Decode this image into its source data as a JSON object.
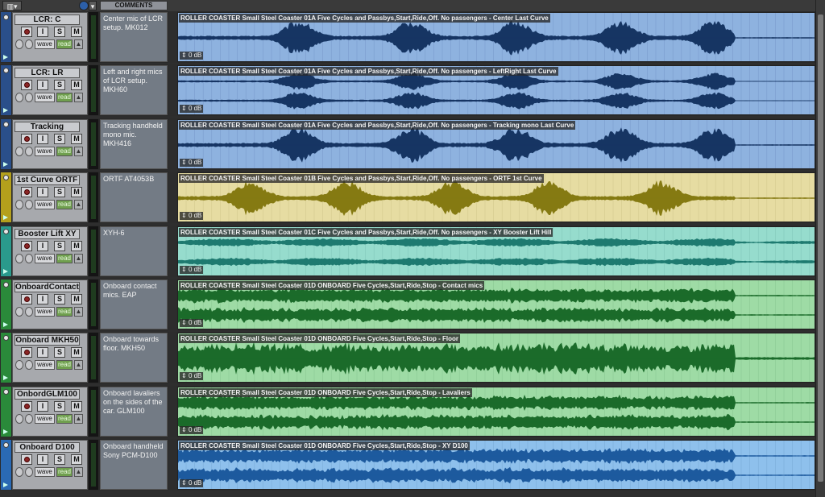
{
  "toolbar": {
    "view_menu_icon": "tracks-view-icon",
    "comments_header": "COMMENTS",
    "insert_icon": "info-icon"
  },
  "tracks": [
    {
      "name": "LCR: C",
      "comment": "Center mic of LCR setup. MK012",
      "clip_title": "ROLLER COASTER Small Steel Coaster 01A Five Cycles and Passbys,Start,Ride,Off. No passengers - Center Last Curve",
      "gain": "0 dB",
      "colors": {
        "strip": "#2a4f8a",
        "bg": "#8eb2df",
        "wave": "#163563",
        "grid": "#7a9ccd"
      },
      "wave_style": "mono-peaks",
      "buttons": {
        "rec": "",
        "input": "I",
        "solo": "S",
        "mute": "M",
        "wave": "wave",
        "read": "read",
        "auto": "▲"
      }
    },
    {
      "name": "LCR: LR",
      "comment": "Left and right mics of LCR setup. MKH60",
      "clip_title": "ROLLER COASTER Small Steel Coaster 01A Five Cycles and Passbys,Start,Ride,Off. No passengers - LeftRight Last Curve",
      "gain": "0 dB",
      "colors": {
        "strip": "#2a4f8a",
        "bg": "#8eb2df",
        "wave": "#163563",
        "grid": "#7a9ccd"
      },
      "wave_style": "stereo-peaks",
      "buttons": {
        "rec": "",
        "input": "I",
        "solo": "S",
        "mute": "M",
        "wave": "wave",
        "read": "read",
        "auto": "▲"
      }
    },
    {
      "name": "Tracking",
      "comment": "Tracking handheld mono mic. MKH416",
      "clip_title": "ROLLER COASTER Small Steel Coaster 01A Five Cycles and Passbys,Start,Ride,Off. No passengers - Tracking mono Last Curve",
      "gain": "0 dB",
      "colors": {
        "strip": "#2a4f8a",
        "bg": "#8eb2df",
        "wave": "#163563",
        "grid": "#7a9ccd"
      },
      "wave_style": "mono-peaks",
      "buttons": {
        "rec": "",
        "input": "I",
        "solo": "S",
        "mute": "M",
        "wave": "wave",
        "read": "read",
        "auto": "▲"
      }
    },
    {
      "name": "1st Curve ORTF",
      "comment": "ORTF AT4053B",
      "clip_title": "ROLLER COASTER Small Steel Coaster 01B Five Cycles and Passbys,Start,Ride,Off. No passengers - ORTF 1st Curve",
      "gain": "0 dB",
      "colors": {
        "strip": "#b4a01c",
        "bg": "#e6dca2",
        "wave": "#857a12",
        "grid": "#d4ca8e"
      },
      "wave_style": "mono-peaks",
      "buttons": {
        "rec": "",
        "input": "I",
        "solo": "S",
        "mute": "M",
        "wave": "wave",
        "read": "read",
        "auto": "▲"
      }
    },
    {
      "name": "Booster Lift XY",
      "comment": "XYH-6",
      "clip_title": "ROLLER COASTER Small Steel Coaster 01C Five Cycles and Passbys,Start,Ride,Off. No passengers - XY Booster Lift Hill",
      "gain": "0 dB",
      "colors": {
        "strip": "#2a9a8c",
        "bg": "#96dccd",
        "wave": "#1e7a70",
        "grid": "#82c8ba"
      },
      "wave_style": "stereo-bumps",
      "buttons": {
        "rec": "",
        "input": "I",
        "solo": "S",
        "mute": "M",
        "wave": "wave",
        "read": "read",
        "auto": "▲"
      }
    },
    {
      "name": "OnboardContact",
      "comment": "Onboard contact mics. EAP",
      "clip_title": "ROLLER COASTER Small Steel Coaster 01D ONBOARD Five Cycles,Start,Ride,Stop - Contact mics",
      "gain": "0 dB",
      "colors": {
        "strip": "#2a8a3a",
        "bg": "#9edba5",
        "wave": "#1b6b2a",
        "grid": "#8ac893"
      },
      "wave_style": "stereo-dense",
      "buttons": {
        "rec": "",
        "input": "I",
        "solo": "S",
        "mute": "M",
        "wave": "wave",
        "read": "read",
        "auto": "▲"
      }
    },
    {
      "name": "Onboard MKH50",
      "comment": "Onboard towards floor. MKH50",
      "clip_title": "ROLLER COASTER Small Steel Coaster 01D ONBOARD Five Cycles,Start,Ride,Stop - Floor",
      "gain": "0 dB",
      "colors": {
        "strip": "#2a8a3a",
        "bg": "#9edba5",
        "wave": "#1b6b2a",
        "grid": "#8ac893"
      },
      "wave_style": "mono-dense",
      "buttons": {
        "rec": "",
        "input": "I",
        "solo": "S",
        "mute": "M",
        "wave": "wave",
        "read": "read",
        "auto": "▲"
      }
    },
    {
      "name": "OnbordGLM100",
      "comment": "Onboard lavaliers on the sides of the car. GLM100",
      "clip_title": "ROLLER COASTER Small Steel Coaster 01D ONBOARD Five Cycles,Start,Ride,Stop - Lavaliers",
      "gain": "0 dB",
      "colors": {
        "strip": "#2a8a3a",
        "bg": "#9edba5",
        "wave": "#1b6b2a",
        "grid": "#8ac893"
      },
      "wave_style": "stereo-dense",
      "buttons": {
        "rec": "",
        "input": "I",
        "solo": "S",
        "mute": "M",
        "wave": "wave",
        "read": "read",
        "auto": "▲"
      }
    },
    {
      "name": "Onboard D100",
      "comment": "Onboard handheld Sony PCM-D100",
      "clip_title": "ROLLER COASTER Small Steel Coaster 01D ONBOARD Five Cycles,Start,Ride,Stop - XY D100",
      "gain": "0 dB",
      "colors": {
        "strip": "#2a6ab4",
        "bg": "#8ec0ec",
        "wave": "#1d5a9e",
        "grid": "#7aacd9"
      },
      "wave_style": "stereo-dense",
      "buttons": {
        "rec": "",
        "input": "I",
        "solo": "S",
        "mute": "M",
        "wave": "wave",
        "read": "read",
        "auto": "▲"
      }
    }
  ]
}
